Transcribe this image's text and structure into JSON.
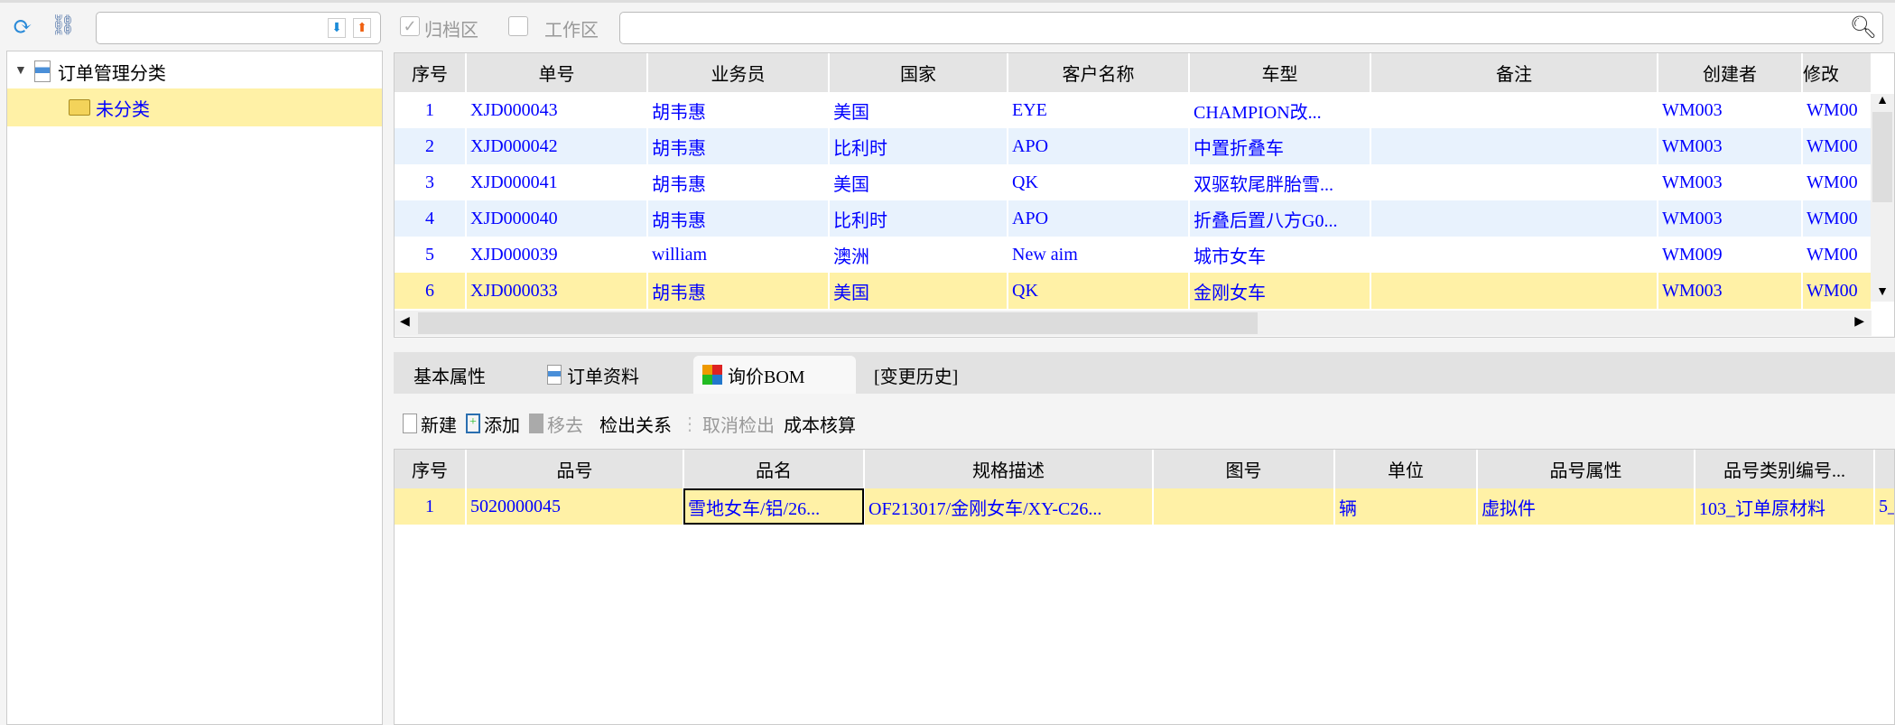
{
  "toolbar": {
    "archive_label": "归档区",
    "archive_checked": true,
    "work_label": "工作区",
    "work_checked": false,
    "search_value": "",
    "filter_value": ""
  },
  "tree": {
    "root": "订单管理分类",
    "child": "未分类"
  },
  "orders": {
    "columns": [
      "序号",
      "单号",
      "业务员",
      "国家",
      "客户名称",
      "车型",
      "备注",
      "创建者",
      "修改"
    ],
    "rows": [
      [
        "1",
        "XJD000043",
        "胡韦惠",
        "美国",
        "EYE",
        "CHAMPION改...",
        "",
        "WM003",
        "WM00"
      ],
      [
        "2",
        "XJD000042",
        "胡韦惠",
        "比利时",
        "APO",
        "中置折叠车",
        "",
        "WM003",
        "WM00"
      ],
      [
        "3",
        "XJD000041",
        "胡韦惠",
        "美国",
        "QK",
        "双驱软尾胖胎雪...",
        "",
        "WM003",
        "WM00"
      ],
      [
        "4",
        "XJD000040",
        "胡韦惠",
        "比利时",
        "APO",
        "折叠后置八方G0...",
        "",
        "WM003",
        "WM00"
      ],
      [
        "5",
        "XJD000039",
        "william",
        "澳洲",
        "New aim",
        "城市女车",
        "",
        "WM009",
        "WM00"
      ],
      [
        "6",
        "XJD000033",
        "胡韦惠",
        "美国",
        "QK",
        "金刚女车",
        "",
        "WM003",
        "WM00"
      ]
    ],
    "selected_row": 6
  },
  "tabs": [
    {
      "label": "基本属性"
    },
    {
      "label": "订单资料"
    },
    {
      "label": "询价BOM",
      "active": true
    },
    {
      "label": "[变更历史]"
    }
  ],
  "bom_toolbar": {
    "new": "新建",
    "add": "添加",
    "remove": "移去",
    "checkout_rel": "检出关系",
    "cancel_checkout": "取消检出",
    "cost": "成本核算"
  },
  "bom": {
    "columns": [
      "序号",
      "品号",
      "品名",
      "规格描述",
      "图号",
      "单位",
      "品号属性",
      "品号类别编号..."
    ],
    "rows": [
      [
        "1",
        "5020000045",
        "雪地女车/铝/26...",
        "OF213017/金刚女车/XY-C26...",
        "",
        "辆",
        "虚拟件",
        "103_订单原材料",
        "5_"
      ]
    ]
  }
}
